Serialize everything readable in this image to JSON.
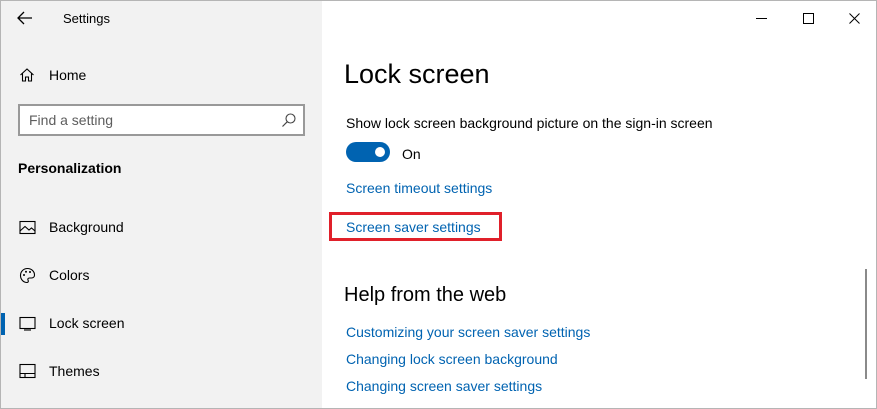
{
  "window": {
    "title": "Settings",
    "controls": [
      "minimize-icon",
      "maximize-icon",
      "close-icon"
    ]
  },
  "sidebar": {
    "home_label": "Home",
    "search": {
      "placeholder": "Find a setting",
      "value": ""
    },
    "section_heading": "Personalization",
    "items": [
      {
        "label": "Background",
        "icon": "picture-icon",
        "active": false
      },
      {
        "label": "Colors",
        "icon": "palette-icon",
        "active": false
      },
      {
        "label": "Lock screen",
        "icon": "lock-screen-icon",
        "active": true
      },
      {
        "label": "Themes",
        "icon": "themes-icon",
        "active": false
      }
    ]
  },
  "main": {
    "page_title": "Lock screen",
    "signin_setting": {
      "label": "Show lock screen background picture on the sign-in screen",
      "state": "On"
    },
    "links": {
      "screen_timeout": "Screen timeout settings",
      "screen_saver": "Screen saver settings"
    },
    "help": {
      "title": "Help from the web",
      "links": [
        "Customizing your screen saver settings",
        "Changing lock screen background",
        "Changing screen saver settings"
      ]
    }
  },
  "colors": {
    "accent": "#0063b1",
    "highlight": "#e0202a",
    "sidebar_bg": "#f2f2f2"
  }
}
